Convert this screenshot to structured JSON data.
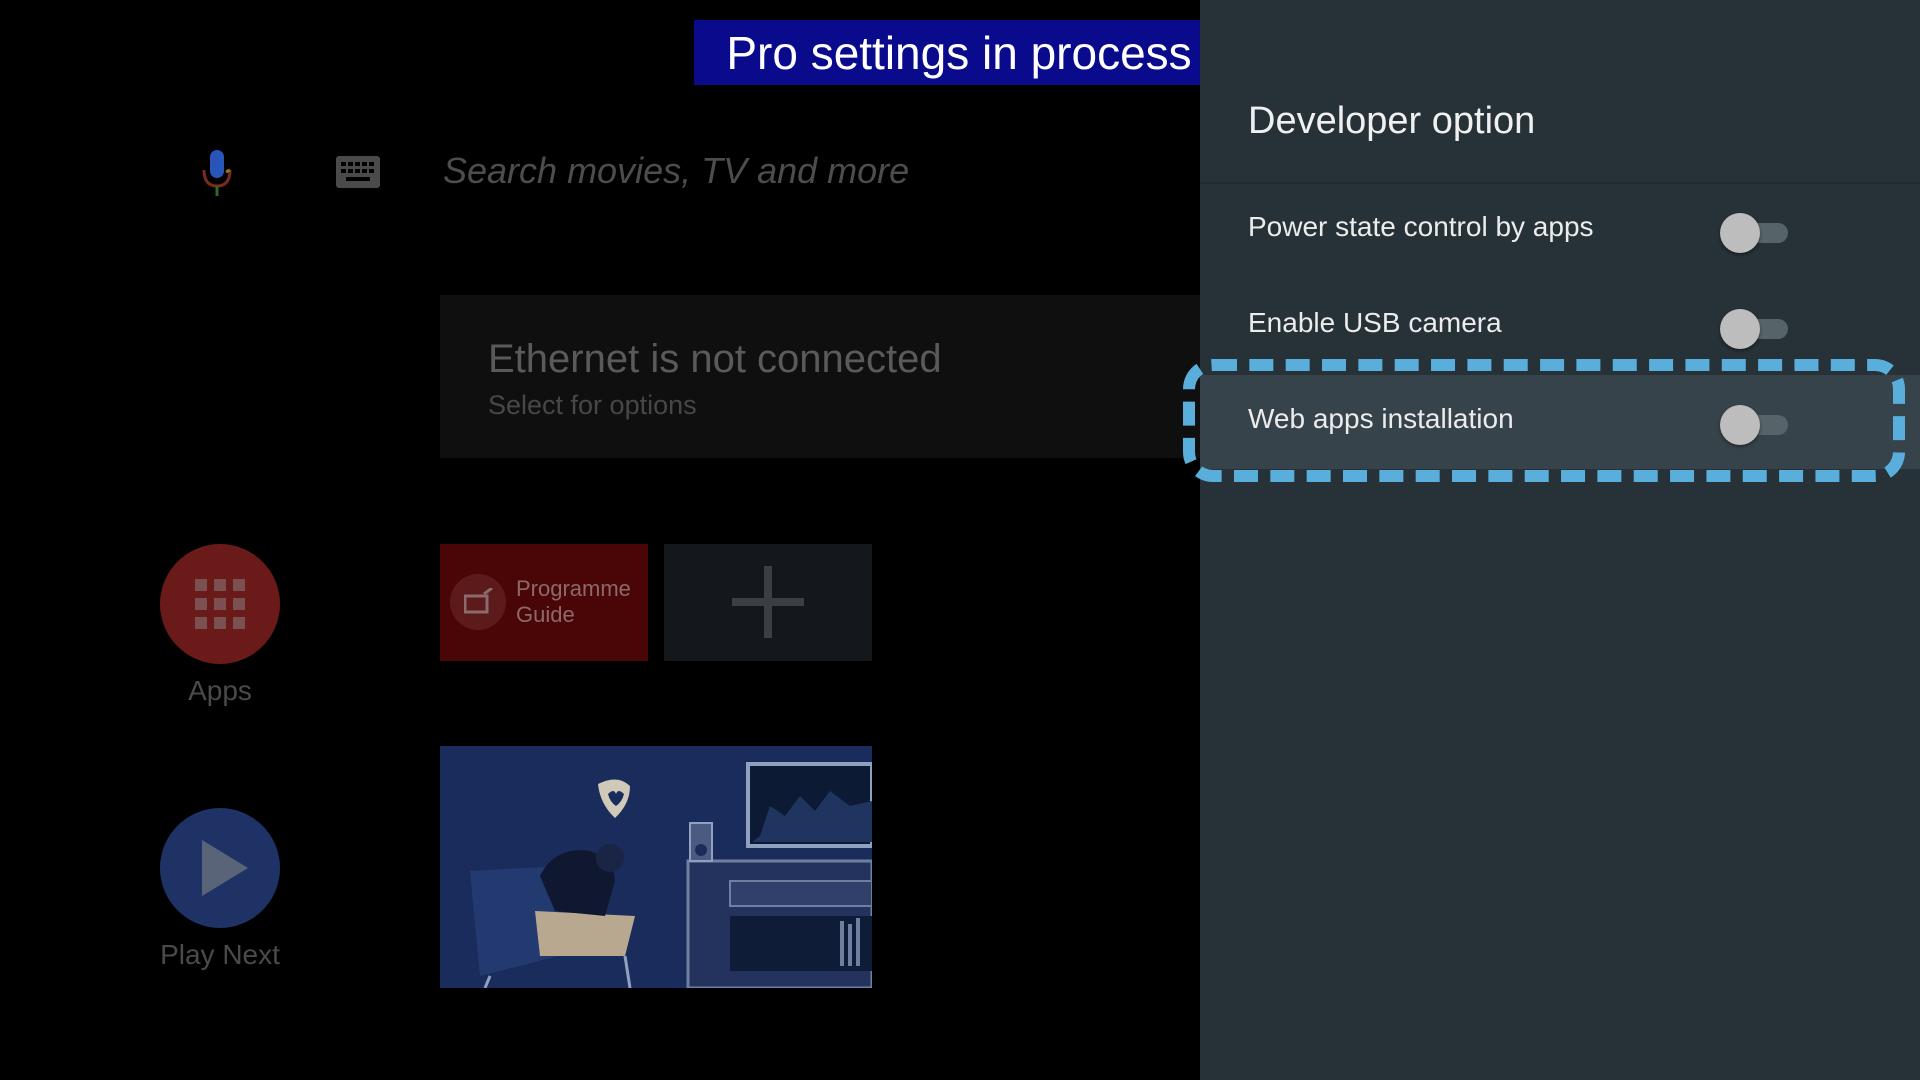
{
  "banner": {
    "text": "Pro settings in process"
  },
  "home": {
    "search_placeholder": "Search movies, TV and more",
    "ethernet": {
      "title": "Ethernet is not connected",
      "subtitle": "Select for options"
    },
    "apps_label": "Apps",
    "play_next_label": "Play Next",
    "programme_guide_label": "Programme Guide",
    "icons": [
      "mic-icon",
      "keyboard-icon",
      "apps-grid-icon",
      "play-icon",
      "tv-guide-icon",
      "plus-icon"
    ]
  },
  "panel": {
    "title": "Developer option",
    "options": [
      {
        "label": "Power state control by apps",
        "enabled": false
      },
      {
        "label": "Enable USB camera",
        "enabled": false
      },
      {
        "label": "Web apps installation",
        "enabled": false,
        "focused": true
      }
    ]
  },
  "colors": {
    "panel_bg": "#263238",
    "focused_row": "#37434a",
    "highlight_border": "#5aaedb",
    "banner_bg": "#0a0a8c"
  }
}
